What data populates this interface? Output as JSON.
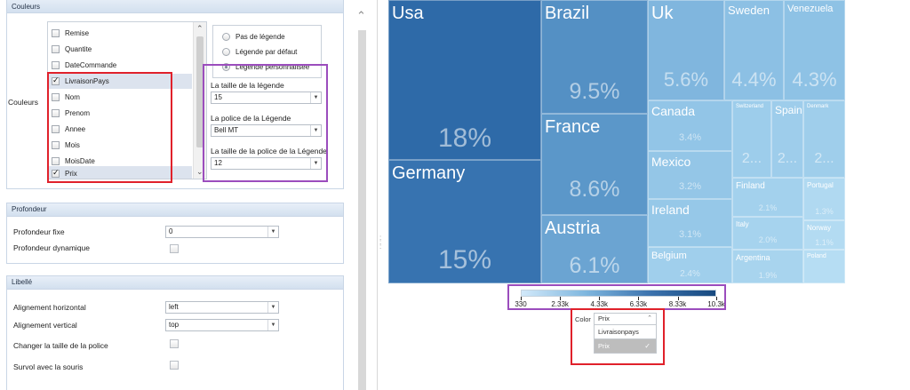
{
  "couleurs": {
    "header": "Couleurs",
    "row_label": "Couleurs",
    "fields": [
      {
        "label": "Remise",
        "checked": false
      },
      {
        "label": "Quantite",
        "checked": false
      },
      {
        "label": "DateCommande",
        "checked": false
      },
      {
        "label": "LivraisonPays",
        "checked": true
      },
      {
        "label": "Nom",
        "checked": false
      },
      {
        "label": "Prenom",
        "checked": false
      },
      {
        "label": "Annee",
        "checked": false
      },
      {
        "label": "Mois",
        "checked": false
      },
      {
        "label": "MoisDate",
        "checked": false
      },
      {
        "label": "Prix",
        "checked": true
      }
    ],
    "legend": {
      "options": [
        "Pas de légende",
        "Légende par défaut",
        "Légende personnalisée"
      ],
      "selected": "Légende personnalisée",
      "size_label": "La taille de la légende",
      "size_value": "15",
      "font_label": "La police de la Légende",
      "font_value": "Bell MT",
      "font_size_label": "La taille de la police de la Légende",
      "font_size_value": "12"
    }
  },
  "profondeur": {
    "header": "Profondeur",
    "fixed_label": "Profondeur fixe",
    "fixed_value": "0",
    "dynamic_label": "Profondeur dynamique",
    "dynamic_checked": false
  },
  "libelle": {
    "header": "Libellé",
    "h_align_label": "Alignement horizontal",
    "h_align_value": "left",
    "v_align_label": "Alignement vertical",
    "v_align_value": "top",
    "font_resize_label": "Changer la taille de la police",
    "font_resize_checked": false,
    "hover_label": "Survol avec la souris",
    "hover_checked": false
  },
  "chart_data": {
    "type": "treemap",
    "items": [
      {
        "name": "Usa",
        "value": "18%",
        "color": "#2e6aa8"
      },
      {
        "name": "Germany",
        "value": "15%",
        "color": "#3773b0"
      },
      {
        "name": "Brazil",
        "value": "9.5%",
        "color": "#5490c4"
      },
      {
        "name": "France",
        "value": "8.6%",
        "color": "#5b97c9"
      },
      {
        "name": "Austria",
        "value": "6.1%",
        "color": "#6ba4d2"
      },
      {
        "name": "Uk",
        "value": "5.6%",
        "color": "#80b6de"
      },
      {
        "name": "Sweden",
        "value": "4.4%",
        "color": "#8cc0e4"
      },
      {
        "name": "Venezuela",
        "value": "4.3%",
        "color": "#8ec2e5"
      },
      {
        "name": "Canada",
        "value": "3.4%",
        "color": "#92c5e7"
      },
      {
        "name": "Mexico",
        "value": "3.2%",
        "color": "#94c6e7"
      },
      {
        "name": "Ireland",
        "value": "3.1%",
        "color": "#96c8e8"
      },
      {
        "name": "Belgium",
        "value": "2.4%",
        "color": "#a0cfec"
      },
      {
        "name": "Switzerland",
        "value": "2...",
        "color": "#9dcdeb"
      },
      {
        "name": "Spain",
        "value": "2...",
        "color": "#9ecdeb"
      },
      {
        "name": "Denmark",
        "value": "2...",
        "color": "#9fceeb"
      },
      {
        "name": "Finland",
        "value": "2.1%",
        "color": "#a3d1ed"
      },
      {
        "name": "Portugal",
        "value": "1.3%",
        "color": "#b0d9f1"
      },
      {
        "name": "Italy",
        "value": "2.0%",
        "color": "#a6d3ee"
      },
      {
        "name": "Norway",
        "value": "1.1%",
        "color": "#b3dbf2"
      },
      {
        "name": "Argentina",
        "value": "1.9%",
        "color": "#a8d4ee"
      },
      {
        "name": "Poland",
        "value": "",
        "color": "#b6ddf3"
      }
    ],
    "color_scale": {
      "ticks": [
        "330",
        "2.33k",
        "4.33k",
        "6.33k",
        "8.33k",
        "10.3k"
      ],
      "tick_values": [
        330,
        2330,
        4330,
        6330,
        8330,
        10300
      ],
      "range": [
        330,
        10300
      ]
    }
  },
  "color_picker": {
    "label": "Color",
    "selected": "Prix",
    "options": [
      "Livraisonpays",
      "Prix"
    ]
  }
}
